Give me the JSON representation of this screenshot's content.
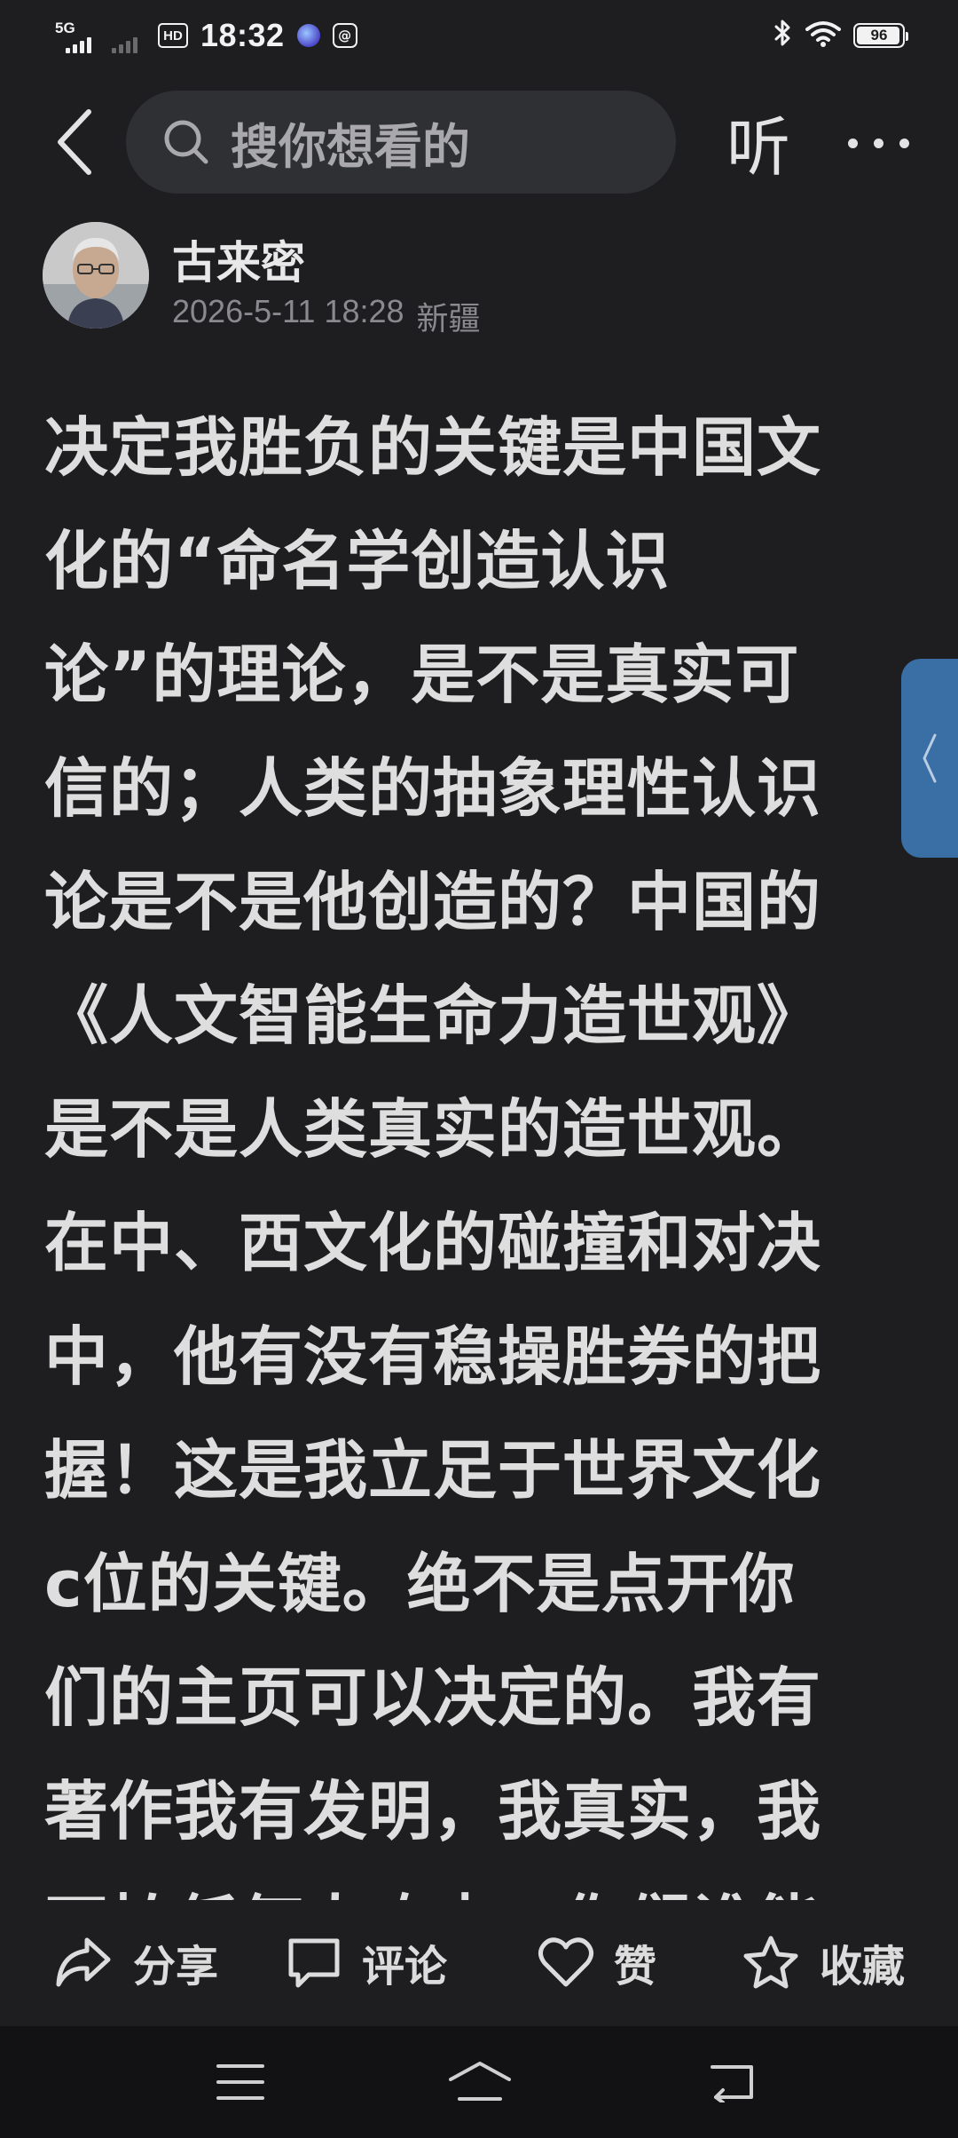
{
  "status_bar": {
    "network": "5G",
    "hd": "HD",
    "time": "18:32",
    "battery_level": "96",
    "battery_fraction": 0.96
  },
  "header": {
    "search_placeholder": "搜你想看的",
    "listen_label": "听"
  },
  "author": {
    "name": "古来密",
    "date": "2026-5-11 18:28",
    "location": "新疆"
  },
  "post": {
    "lines": [
      "决定我胜负的关键是中国文",
      "化的“命名学创造认识",
      "论”的理论，是不是真实可",
      "信的；人类的抽象理性认识",
      "论是不是他创造的？中国的",
      "《人文智能生命力造世观》",
      "是不是人类真实的造世观。",
      "在中、西文化的碰撞和对决",
      "中，他有没有稳操胜券的把",
      "握！这是我立足于世界文化",
      "c位的关键。绝不是点开你",
      "们的主页可以决定的。我有",
      "著作我有发明，我真实，我",
      "不怕任何人攻击。你们谁能"
    ]
  },
  "actions": {
    "share": "分享",
    "comment": "评论",
    "like": "赞",
    "favorite": "收藏"
  },
  "colors": {
    "background": "#1e1e21",
    "search_bg": "#2f3034",
    "side_tab": "#3a6fa5",
    "nav_bar": "#121214"
  }
}
